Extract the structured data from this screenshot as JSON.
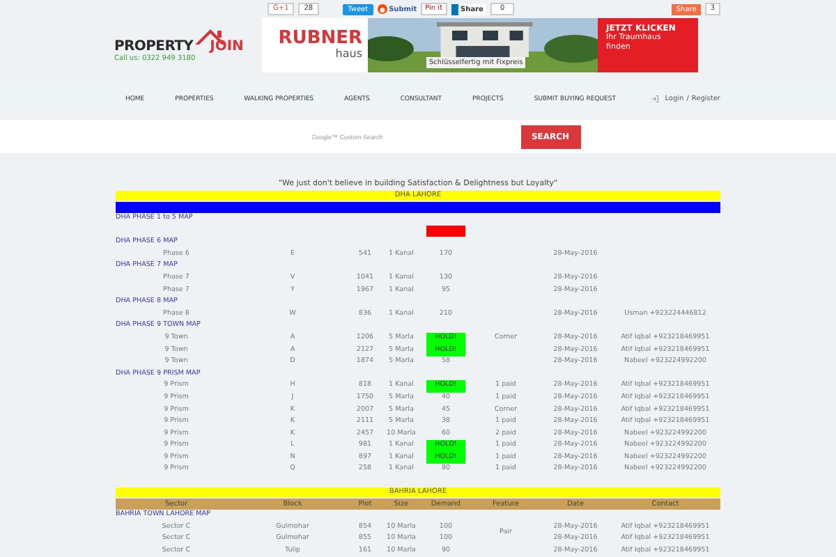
{
  "social": {
    "gplus": {
      "label": "G+1",
      "count": "28"
    },
    "tweet": "Tweet",
    "submit": "Submit",
    "pin": "Pin it",
    "linkedin": {
      "label": "Share",
      "count": "0"
    },
    "share": {
      "label": "Share",
      "count": "3"
    }
  },
  "logo": {
    "word1": "PROPERTY",
    "word2": "JOIN",
    "phone": "Call us: 0322 949 3180"
  },
  "ad": {
    "brand": "RUBNER",
    "sub": "haus",
    "caption": "Schlüsselfertig mit Fixpreis",
    "cta": "JETZT KLICKEN",
    "cta_text": "Ihr Traumhaus finden"
  },
  "nav": [
    "HOME",
    "PROPERTIES",
    "WALKING PROPERTIES",
    "AGENTS",
    "CONSULTANT",
    "PROJECTS",
    "SUBMIT BUYING REQUEST"
  ],
  "account": {
    "login": "Login",
    "separator": "/",
    "register": "Register"
  },
  "search": {
    "placeholder": "Google™ Custom Search",
    "button": "SEARCH"
  },
  "tagline": "\"We just don't believe in building Satisfaction & Delightness but Loyalty\"",
  "sections": [
    {
      "title": "DHA LAHORE",
      "color": "#0000ff",
      "groups": [
        {
          "title": "DHA PHASE 1 to 5 MAP",
          "rows": [
            {
              "color": "#ff0000"
            }
          ]
        },
        {
          "title": "DHA PHASE 6 MAP",
          "rows": [
            {
              "sector": "Phase 6",
              "block": "E",
              "plot": "541",
              "size": "1 Kanal",
              "demand": "170",
              "date": "28-May-2016"
            }
          ]
        },
        {
          "title": "DHA PHASE 7 MAP",
          "rows": [
            {
              "sector": "Phase 7",
              "block": "V",
              "plot": "1041",
              "size": "1 Kanal",
              "demand": "130",
              "date": "28-May-2016"
            },
            {
              "sector": "Phase 7",
              "block": "Y",
              "plot": "1967",
              "size": "1 Kanal",
              "demand": "95",
              "date": "28-May-2016"
            }
          ]
        },
        {
          "title": "DHA PHASE 8 MAP",
          "rows": [
            {
              "sector": "Phase 8",
              "block": "W",
              "plot": "836",
              "size": "1 Kanal",
              "demand": "210",
              "date": "28-May-2016",
              "contact": "Usman +923224446812"
            }
          ]
        },
        {
          "title": "DHA PHASE 9 TOWN MAP",
          "rows": [
            {
              "sector": "9 Town",
              "block": "A",
              "plot": "1206",
              "size": "5 Marla",
              "demand": "HOLD!",
              "color": "#00ff00",
              "feature": "Corner",
              "date": "28-May-2016",
              "contact": "Atif Iqbal +923218469951"
            },
            {
              "sector": "9 Town",
              "block": "A",
              "plot": "2127",
              "size": "5 Marla",
              "demand": "HOLD!",
              "color": "#00ff00",
              "date": "28-May-2016",
              "contact": "Atif Iqbal +923218469951"
            },
            {
              "sector": "9 Town",
              "block": "D",
              "plot": "1874",
              "size": "5 Marla",
              "demand": "58",
              "date": "28-May-2016",
              "contact": "Nabeel +923224992200"
            }
          ]
        },
        {
          "title": "DHA PHASE 9 PRISM MAP",
          "rows": [
            {
              "sector": "9 Prism",
              "block": "H",
              "plot": "818",
              "size": "1 Kanal",
              "demand": "HOLD!",
              "color": "#00ff00",
              "feature": "1 paid",
              "date": "28-May-2016",
              "contact": "Atif Iqbal +923218469951"
            },
            {
              "sector": "9 Prism",
              "block": "J",
              "plot": "1750",
              "size": "5 Marla",
              "demand": "40",
              "feature": "1 paid",
              "date": "28-May-2016",
              "contact": "Atif Iqbal +923218469951"
            },
            {
              "sector": "9 Prism",
              "block": "K",
              "plot": "2007",
              "size": "5 Marla",
              "demand": "45",
              "feature": "Corner",
              "date": "28-May-2016",
              "contact": "Atif Iqbal +923218469951"
            },
            {
              "sector": "9 Prism",
              "block": "K",
              "plot": "2111",
              "size": "5 Marla",
              "demand": "38",
              "feature": "1 paid",
              "date": "28-May-2016",
              "contact": "Atif Iqbal +923218469951"
            },
            {
              "sector": "9 Prism",
              "block": "K",
              "plot": "2457",
              "size": "10 Marla",
              "demand": "60",
              "feature": "2 paid",
              "date": "28-May-2016",
              "contact": "Nabeel +923224992200"
            },
            {
              "sector": "9 Prism",
              "block": "L",
              "plot": "981",
              "size": "1 Kanal",
              "demand": "HOLD!",
              "color": "#00ff00",
              "feature": "1 paid",
              "date": "28-May-2016",
              "contact": "Nabeel +923224992200"
            },
            {
              "sector": "9 Prism",
              "block": "N",
              "plot": "897",
              "size": "1 Kanal",
              "demand": "HOLD!",
              "color": "#00ff00",
              "feature": "1 paid",
              "date": "28-May-2016",
              "contact": "Nabeel +923224992200"
            },
            {
              "sector": "9 Prism",
              "block": "Q",
              "plot": "258",
              "size": "1 Kanal",
              "demand": "80",
              "feature": "1 paid",
              "date": "28-May-2016",
              "contact": "Nabeel +923224992200"
            }
          ]
        }
      ]
    },
    {
      "title": "BAHRIA LAHORE",
      "color": "#c8a05a",
      "columns": [
        "Sector",
        "Block",
        "Plot",
        "Size",
        "Demand",
        "Feature",
        "Date",
        "Contact"
      ],
      "groups": [
        {
          "title": "BAHRIA TOWN LAHORE MAP",
          "rows": [
            {
              "sector": "Sector C",
              "block": "Gulmohar",
              "plot": "854",
              "size": "10 Marla",
              "demand": "100",
              "feature": "Pair",
              "date": "28-May-2016",
              "contact": "Atif Iqbal +923218469951"
            },
            {
              "sector": "Sector C",
              "block": "Gulmohar",
              "plot": "855",
              "size": "10 Marla",
              "demand": "100",
              "feature_merged": true,
              "date": "28-May-2016",
              "contact": "Atif Iqbal +923218469951"
            },
            {
              "sector": "Sector C",
              "block": "Tulip",
              "plot": "161",
              "size": "10 Marla",
              "demand": "90",
              "date": "28-May-2016",
              "contact": "Atif Iqbal +923218469951"
            }
          ]
        }
      ]
    }
  ]
}
